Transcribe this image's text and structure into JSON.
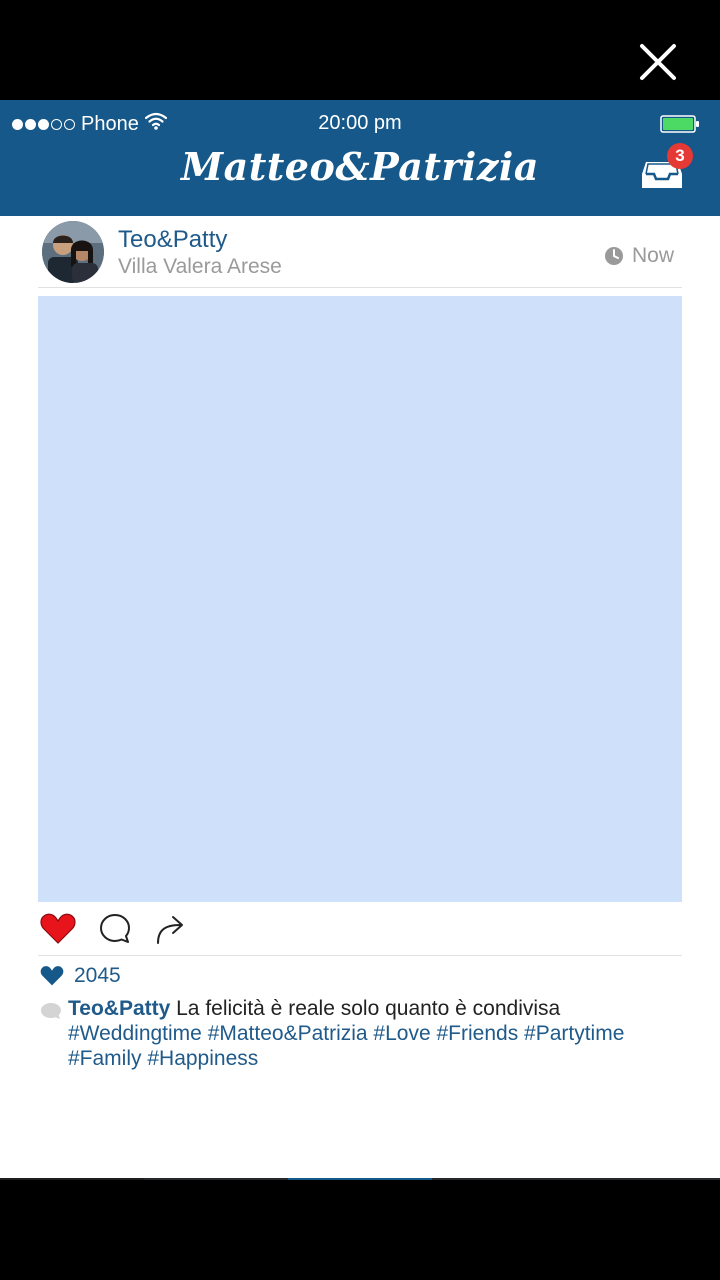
{
  "status_bar": {
    "carrier": "Phone",
    "time": "20:00 pm"
  },
  "header": {
    "title": "Matteo&Patrizia",
    "inbox_badge": "3"
  },
  "post": {
    "username": "Teo&Patty",
    "location": "Villa Valera Arese",
    "time": "Now",
    "likes": "2045",
    "caption_user": "Teo&Patty",
    "caption_text": " La felicità è reale solo quanto è condivisa",
    "hashtags_line1": "#Weddingtime #Matteo&Patrizia #Love #Friends #Partytime",
    "hashtags_line2": "#Family #Happiness"
  },
  "colors": {
    "brand_blue": "#155889",
    "photo_placeholder": "#cfe0fb",
    "like_red": "#e8141b"
  },
  "icons": [
    "close-icon",
    "wifi-icon",
    "battery-icon",
    "inbox-icon",
    "clock-icon",
    "heart-icon",
    "comment-icon",
    "share-icon",
    "home-icon",
    "search-icon",
    "camera-icon",
    "activity-icon",
    "profile-icon"
  ]
}
